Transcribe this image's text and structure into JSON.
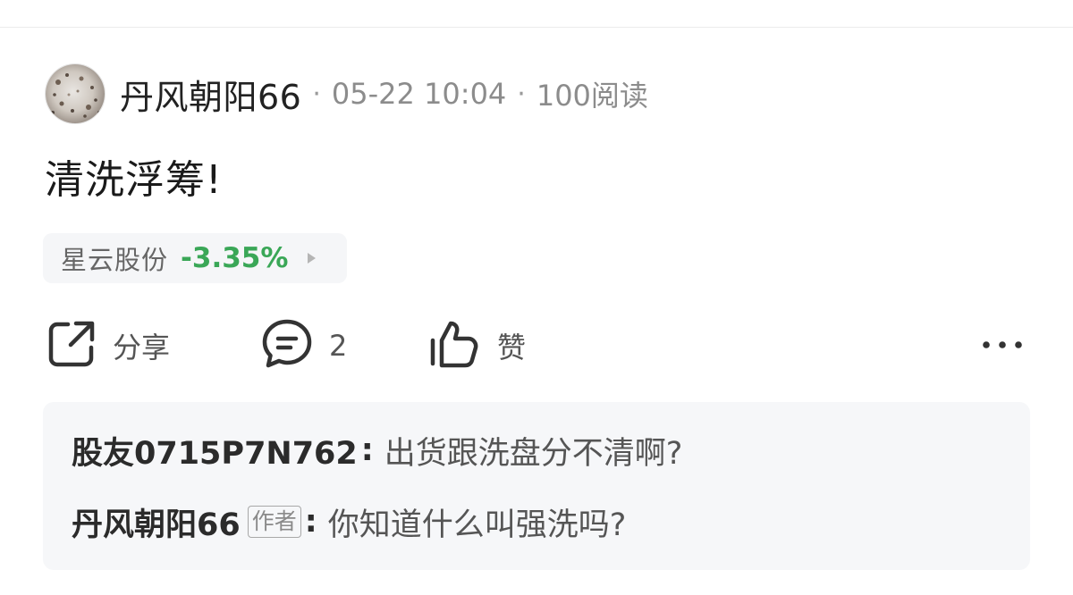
{
  "post": {
    "author": "丹风朝阳66",
    "date": "05-22 10:04",
    "reads": "100阅读",
    "separator": "·",
    "text": "清洗浮筹!"
  },
  "stock": {
    "name": "星云股份",
    "change": "-3.35%",
    "change_color": "#3aa757"
  },
  "actions": {
    "share_label": "分享",
    "comment_count": "2",
    "like_label": "赞"
  },
  "comments": [
    {
      "user": "股友0715P7N762",
      "colon": ":",
      "text": "出货跟洗盘分不清啊?"
    },
    {
      "user": "丹风朝阳66",
      "badge": "作者",
      "colon": ":",
      "text": "你知道什么叫强洗吗?"
    }
  ],
  "icons": {
    "share": "share-icon",
    "comment": "comment-icon",
    "like": "thumbs-up-icon",
    "more": "more-icon"
  }
}
